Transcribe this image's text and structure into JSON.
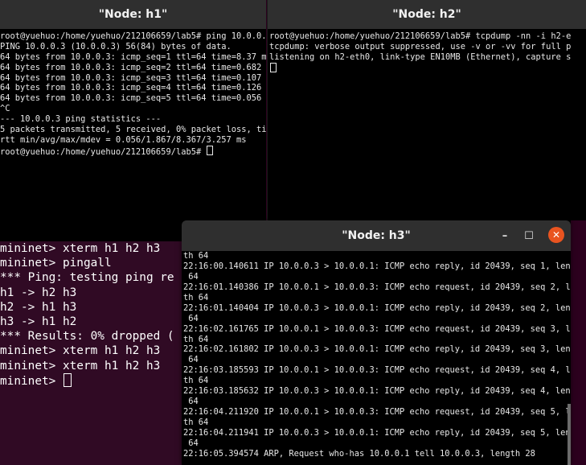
{
  "h1": {
    "title": "\"Node: h1\"",
    "lines": [
      "root@yuehuo:/home/yuehuo/212106659/lab5# ping 10.0.0.3",
      "PING 10.0.0.3 (10.0.0.3) 56(84) bytes of data.",
      "64 bytes from 10.0.0.3: icmp_seq=1 ttl=64 time=8.37 ms",
      "64 bytes from 10.0.0.3: icmp_seq=2 ttl=64 time=0.682 ms",
      "64 bytes from 10.0.0.3: icmp_seq=3 ttl=64 time=0.107 ms",
      "64 bytes from 10.0.0.3: icmp_seq=4 ttl=64 time=0.126 ms",
      "64 bytes from 10.0.0.3: icmp_seq=5 ttl=64 time=0.056 ms",
      "^C",
      "--- 10.0.0.3 ping statistics ---",
      "5 packets transmitted, 5 received, 0% packet loss, time",
      "rtt min/avg/max/mdev = 0.056/1.867/8.367/3.257 ms",
      "root@yuehuo:/home/yuehuo/212106659/lab5# "
    ]
  },
  "h2": {
    "title": "\"Node: h2\"",
    "lines": [
      "root@yuehuo:/home/yuehuo/212106659/lab5# tcpdump -nn -i h2-e",
      "tcpdump: verbose output suppressed, use -v or -vv for full p",
      "listening on h2-eth0, link-type EN10MB (Ethernet), capture s",
      ""
    ]
  },
  "mininet": {
    "lines": [
      "mininet> xterm h1 h2 h3",
      "mininet> pingall",
      "*** Ping: testing ping re",
      "h1 -> h2 h3",
      "h2 -> h1 h3",
      "h3 -> h1 h2",
      "*** Results: 0% dropped (",
      "mininet> xterm h1 h2 h3",
      "mininet> xterm h1 h2 h3",
      "mininet> "
    ]
  },
  "h3": {
    "title": "\"Node: h3\"",
    "minimize": "–",
    "maximize": "☐",
    "close": "✕",
    "lines": [
      "th 64",
      "22:16:00.140611 IP 10.0.0.3 > 10.0.0.1: ICMP echo reply, id 20439, seq 1, length",
      " 64",
      "22:16:01.140386 IP 10.0.0.1 > 10.0.0.3: ICMP echo request, id 20439, seq 2, leng",
      "th 64",
      "22:16:01.140404 IP 10.0.0.3 > 10.0.0.1: ICMP echo reply, id 20439, seq 2, length",
      " 64",
      "22:16:02.161765 IP 10.0.0.1 > 10.0.0.3: ICMP echo request, id 20439, seq 3, leng",
      "th 64",
      "22:16:02.161802 IP 10.0.0.3 > 10.0.0.1: ICMP echo reply, id 20439, seq 3, length",
      " 64",
      "22:16:03.185593 IP 10.0.0.1 > 10.0.0.3: ICMP echo request, id 20439, seq 4, leng",
      "th 64",
      "22:16:03.185632 IP 10.0.0.3 > 10.0.0.1: ICMP echo reply, id 20439, seq 4, length",
      " 64",
      "22:16:04.211920 IP 10.0.0.1 > 10.0.0.3: ICMP echo request, id 20439, seq 5, leng",
      "th 64",
      "22:16:04.211941 IP 10.0.0.3 > 10.0.0.1: ICMP echo reply, id 20439, seq 5, length",
      " 64",
      "22:16:05.394574 ARP, Request who-has 10.0.0.1 tell 10.0.0.3, length 28"
    ]
  },
  "colors": {
    "titlebar": "#2f2f2f",
    "terminal_bg": "#000000",
    "mininet_bg": "#300a24",
    "close_button": "#e95420"
  }
}
